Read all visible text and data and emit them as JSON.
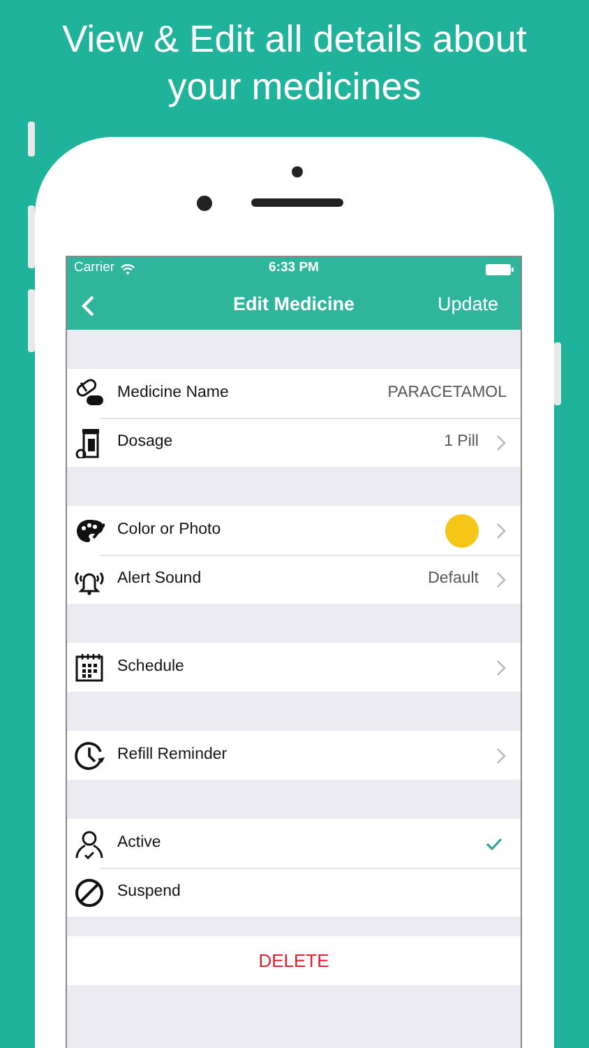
{
  "headline": "View & Edit all details about your medicines",
  "status_bar": {
    "carrier": "Carrier",
    "time": "6:33 PM"
  },
  "nav": {
    "title": "Edit Medicine",
    "action": "Update"
  },
  "sections": [
    {
      "rows": [
        {
          "kind": "value",
          "label": "Medicine Name",
          "value": "PARACETAMOL",
          "chevron": false
        },
        {
          "kind": "value",
          "label": "Dosage",
          "value": "1 Pill",
          "chevron": true
        }
      ]
    },
    {
      "rows": [
        {
          "kind": "color",
          "label": "Color or Photo",
          "color": "#f5c518",
          "chevron": true
        },
        {
          "kind": "value",
          "label": "Alert Sound",
          "value": "Default",
          "chevron": true
        }
      ]
    },
    {
      "rows": [
        {
          "kind": "value",
          "label": "Schedule",
          "chevron": true
        }
      ]
    },
    {
      "rows": [
        {
          "kind": "value",
          "label": "Refill Reminder",
          "chevron": true
        }
      ]
    },
    {
      "rows": [
        {
          "kind": "option",
          "label": "Active",
          "selected": true
        },
        {
          "kind": "option",
          "label": "Suspend",
          "selected": false
        }
      ]
    },
    {
      "rows": [
        {
          "kind": "action",
          "label": "DELETE"
        }
      ]
    }
  ]
}
